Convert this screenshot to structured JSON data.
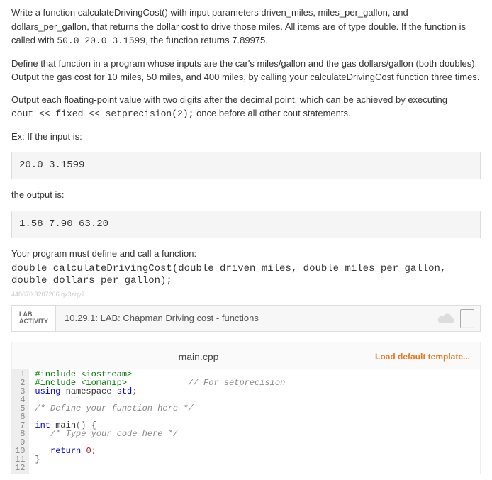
{
  "intro": {
    "p1_a": "Write a function calculateDrivingCost() with input parameters driven_miles, miles_per_gallon, and dollars_per_gallon, that returns the dollar cost to drive those miles. All items are of type double. If the function is called with ",
    "p1_b": "50.0 20.0 3.1599",
    "p1_c": ", the function returns 7.89975.",
    "p2": "Define that function in a program whose inputs are the car's miles/gallon and the gas dollars/gallon (both doubles). Output the gas cost for 10 miles, 50 miles, and 400 miles, by calling your calculateDrivingCost function three times.",
    "p3": "Output each floating-point value with two digits after the decimal point, which can be achieved by executing",
    "p3_code": "cout << fixed << setprecision(2);",
    "p3_tail": " once before all other cout statements.",
    "ex_label": "Ex: If the input is:",
    "ex_input": "20.0 3.1599",
    "output_label": "the output is:",
    "ex_output": "1.58 7.90 63.20",
    "define_label": "Your program must define and call a function:",
    "signature": "double calculateDrivingCost(double driven_miles, double miles_per_gallon, double dollars_per_gallon);",
    "watermark": "448670.3207266.qx3zqy7"
  },
  "lab": {
    "tag_line1": "LAB",
    "tag_line2": "ACTIVITY",
    "title": "10.29.1: LAB: Chapman Driving cost - functions"
  },
  "editor": {
    "filename": "main.cpp",
    "load_template": "Load default template...",
    "lines": [
      {
        "n": "1",
        "type": "pre",
        "t": "#include <iostream>"
      },
      {
        "n": "2",
        "type": "pre2",
        "a": "#include <iomanip>",
        "b": "            // For setprecision"
      },
      {
        "n": "3",
        "type": "using",
        "a": "using",
        "b": " namespace ",
        "c": "std",
        "d": ";"
      },
      {
        "n": "4",
        "type": "blank",
        "t": ""
      },
      {
        "n": "5",
        "type": "com",
        "t": "/* Define your function here */"
      },
      {
        "n": "6",
        "type": "blank",
        "t": ""
      },
      {
        "n": "7",
        "type": "main",
        "a": "int",
        "b": " main",
        "c": "()",
        "d": " {"
      },
      {
        "n": "8",
        "type": "com-indent",
        "t": "   /* Type your code here */"
      },
      {
        "n": "9",
        "type": "blank",
        "t": ""
      },
      {
        "n": "10",
        "type": "ret",
        "a": "   ",
        "b": "return",
        "c": " ",
        "d": "0",
        "e": ";"
      },
      {
        "n": "11",
        "type": "brace",
        "t": "}"
      },
      {
        "n": "12",
        "type": "blank",
        "t": ""
      }
    ]
  }
}
